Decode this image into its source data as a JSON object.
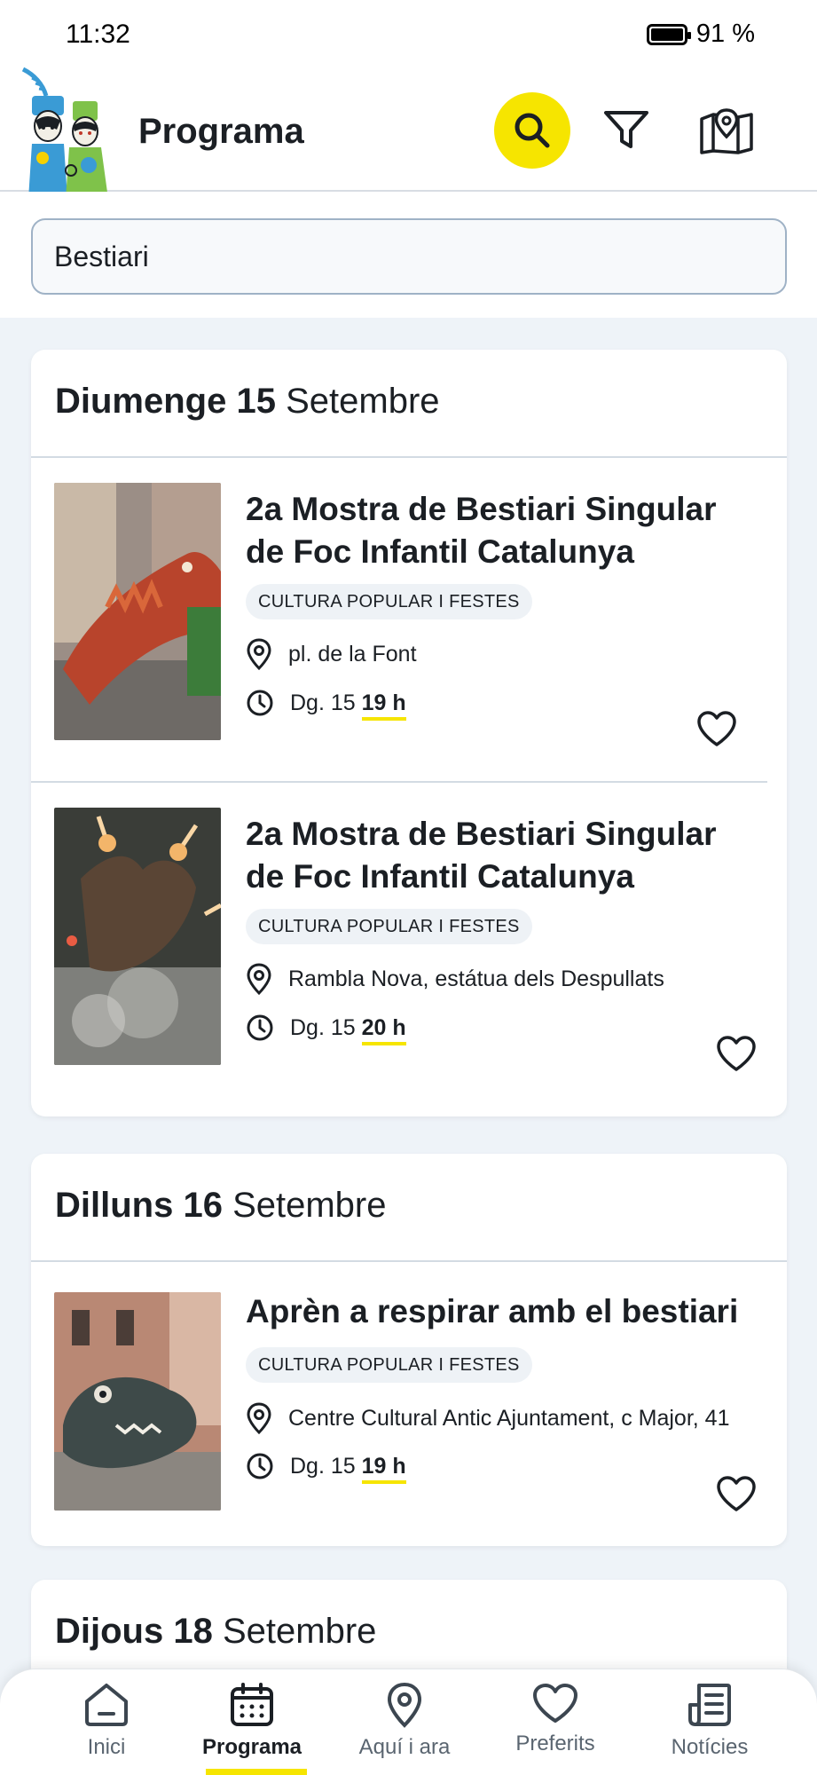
{
  "status_bar": {
    "time": "11:32",
    "battery": "91 %"
  },
  "header": {
    "title": "Programa",
    "logo": "gegants-logo"
  },
  "search": {
    "value": "Bestiari"
  },
  "days": [
    {
      "day_name": "Diumenge 15",
      "month": "Setembre",
      "events": [
        {
          "title": "2a Mostra de Bestiari Singular de Foc Infantil Catalunya",
          "category": "CULTURA POPULAR I FESTES",
          "location": "pl. de la Font",
          "date": "Dg. 15",
          "time": "19 h"
        },
        {
          "title": "2a Mostra de Bestiari Singular de Foc Infantil Catalunya",
          "category": "CULTURA POPULAR I FESTES",
          "location": "Rambla Nova, estátua dels Despullats",
          "date": "Dg. 15",
          "time": "20 h"
        }
      ]
    },
    {
      "day_name": "Dilluns 16",
      "month": "Setembre",
      "events": [
        {
          "title": "Aprèn a respirar amb el bestiari",
          "category": "CULTURA POPULAR I FESTES",
          "location": "Centre Cultural Antic Ajuntament, c Major, 41",
          "date": "Dg. 15",
          "time": "19 h"
        }
      ]
    },
    {
      "day_name": "Dijous 18",
      "month": "Setembre",
      "events": []
    }
  ],
  "bottom_nav": [
    {
      "label": "Inici",
      "icon": "home-icon"
    },
    {
      "label": "Programa",
      "icon": "calendar-icon",
      "active": true
    },
    {
      "label": "Aquí i ara",
      "icon": "location-pin-icon"
    },
    {
      "label": "Preferits",
      "icon": "heart-icon"
    },
    {
      "label": "Notícies",
      "icon": "news-icon"
    }
  ],
  "colors": {
    "accent": "#f6e500",
    "text": "#1b1f24",
    "background": "#eef3f8"
  }
}
